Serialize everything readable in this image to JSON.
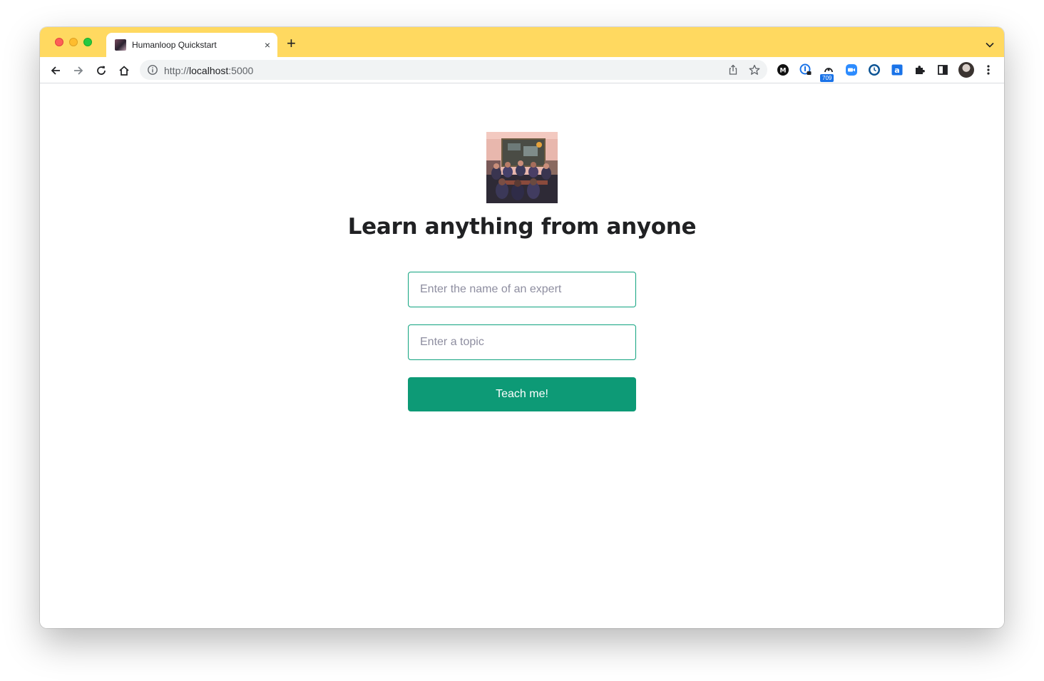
{
  "browser": {
    "tab": {
      "title": "Humanloop Quickstart",
      "close": "×"
    },
    "new_tab": "+",
    "url": {
      "scheme": "http://",
      "host": "localhost",
      "port": ":5000"
    },
    "extension_badge": "709",
    "theme_color": "#ffd960"
  },
  "page": {
    "title": "Learn anything from anyone",
    "expert_placeholder": "Enter the name of an expert",
    "topic_placeholder": "Enter a topic",
    "submit_label": "Teach me!",
    "accent_color": "#10a37f"
  }
}
